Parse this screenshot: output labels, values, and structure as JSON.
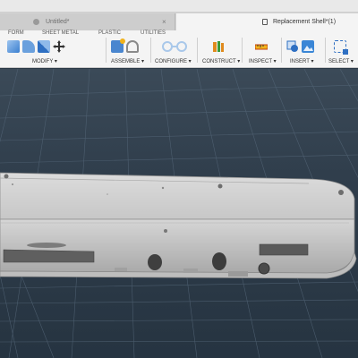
{
  "tabs": {
    "inactive_title": "Untitled*",
    "active_title": "Replacement Shell*(1)",
    "close_glyph": "×"
  },
  "subtabs": [
    "FORM",
    "SHEET METAL",
    "PLASTIC",
    "UTILITIES"
  ],
  "groups": {
    "modify": "MODIFY ▾",
    "assemble": "ASSEMBLE ▾",
    "configure": "CONFIGURE ▾",
    "construct": "CONSTRUCT ▾",
    "inspect": "INSPECT ▾",
    "insert": "INSERT ▾",
    "select": "SELECT ▾"
  },
  "icons": {
    "modify": [
      "push-pull-icon",
      "fillet-icon",
      "chamfer-icon",
      "move-icon"
    ],
    "assemble": [
      "new-component-icon",
      "joint-icon"
    ],
    "configure": [
      "configure-icon"
    ],
    "construct": [
      "offset-plane-icon"
    ],
    "inspect": [
      "measure-icon"
    ],
    "insert": [
      "insert-derive-icon",
      "insert-image-icon"
    ],
    "select": [
      "select-box-icon"
    ]
  },
  "colors": {
    "viewport_bg": "#2f3d4b",
    "grid": "#5e6f80",
    "accent_blue": "#1f6fd1",
    "accent_orange": "#e08a1e",
    "accent_green": "#3a9a3a"
  }
}
